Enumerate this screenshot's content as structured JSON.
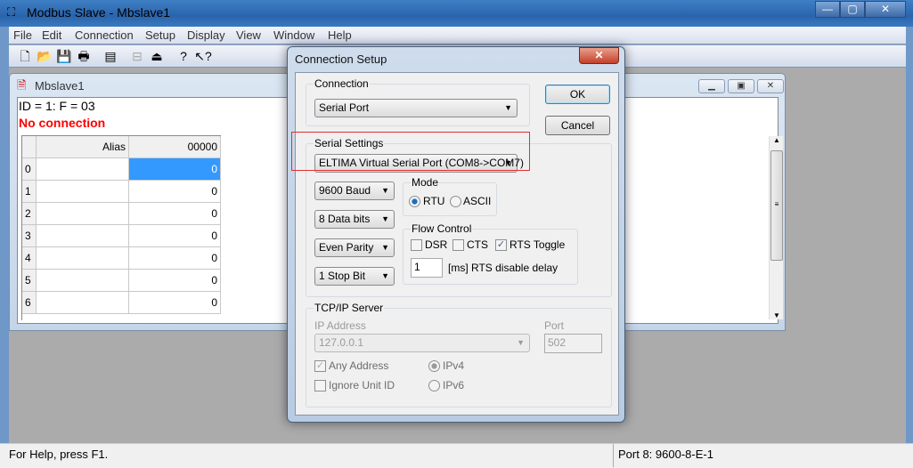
{
  "app": {
    "title": "Modbus Slave - Mbslave1"
  },
  "menu": [
    "File",
    "Edit",
    "Connection",
    "Setup",
    "Display",
    "View",
    "Window",
    "Help"
  ],
  "toolbar": [
    {
      "icon": "new-icon",
      "g": "🗋"
    },
    {
      "icon": "open-icon",
      "g": "📂"
    },
    {
      "icon": "save-icon",
      "g": "💾"
    },
    {
      "icon": "print-icon",
      "g": "🖶"
    },
    {
      "icon": "window-icon",
      "g": "▤"
    },
    {
      "icon": "connect-icon",
      "g": "⊟"
    },
    {
      "icon": "disconnect-icon",
      "g": "⏏"
    },
    {
      "icon": "help-icon",
      "g": "?"
    },
    {
      "icon": "context-help-icon",
      "g": "↖?"
    }
  ],
  "child": {
    "title": "Mbslave1",
    "id_line": "ID = 1: F = 03",
    "status": "No connection",
    "columns": [
      "Alias",
      "00000"
    ],
    "rows": [
      {
        "n": "0",
        "v": "0"
      },
      {
        "n": "1",
        "v": "0"
      },
      {
        "n": "2",
        "v": "0"
      },
      {
        "n": "3",
        "v": "0"
      },
      {
        "n": "4",
        "v": "0"
      },
      {
        "n": "5",
        "v": "0"
      },
      {
        "n": "6",
        "v": "0"
      }
    ]
  },
  "status": {
    "help": "For Help, press F1.",
    "port": "Port 8: 9600-8-E-1"
  },
  "dialog": {
    "title": "Connection Setup",
    "ok": "OK",
    "cancel": "Cancel",
    "connection_label": "Connection",
    "connection_value": "Serial Port",
    "serial_label": "Serial Settings",
    "port_value": "ELTIMA Virtual Serial Port (COM8->COM7)",
    "baud": "9600 Baud",
    "data_bits": "8 Data bits",
    "parity": "Even Parity",
    "stop_bits": "1 Stop Bit",
    "mode_label": "Mode",
    "rtu": "RTU",
    "ascii": "ASCII",
    "mode_selected": "RTU",
    "flow_label": "Flow Control",
    "dsr": "DSR",
    "cts": "CTS",
    "rts_toggle": "RTS Toggle",
    "dsr_checked": false,
    "cts_checked": false,
    "rts_checked": true,
    "rts_delay": "1",
    "rts_delay_label": "[ms] RTS disable delay",
    "tcp_label": "TCP/IP Server",
    "ip_label": "IP Address",
    "ip_value": "127.0.0.1",
    "port_label": "Port",
    "port_value_tcp": "502",
    "any_address": "Any Address",
    "ignore_unit": "Ignore Unit ID",
    "ipv4": "IPv4",
    "ipv6": "IPv6"
  },
  "colors": {
    "error": "#ff0000",
    "highlight": "#3399ff",
    "annotation": "#e03030"
  }
}
